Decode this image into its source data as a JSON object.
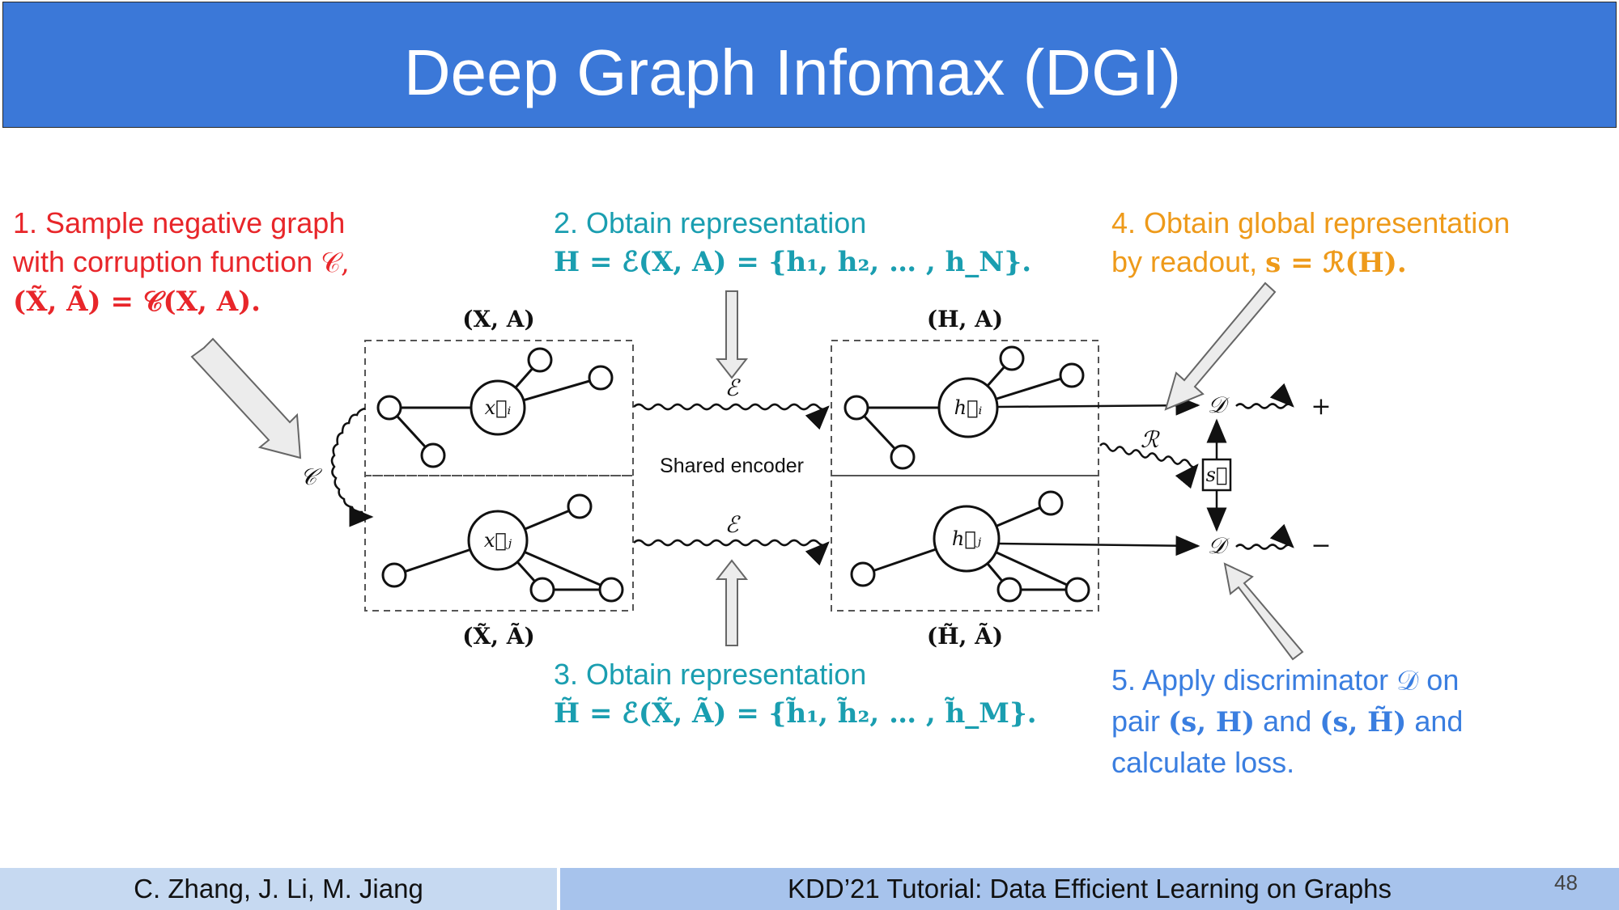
{
  "title": "Deep Graph Infomax (DGI)",
  "step1": {
    "line1": "1. Sample negative graph",
    "line2": "with corruption function ",
    "line2_math": "𝒞,",
    "line3_math": "(X̃, Ã) = 𝒞(X, A)."
  },
  "step2": {
    "line1": "2. Obtain representation",
    "line2_math": "H = ℰ(X, A) = {h₁, h₂, … , h_N}."
  },
  "step3": {
    "line1": "3. Obtain representation",
    "line2_math": "H̃ = ℰ(X̃, Ã) = {h̃₁, h̃₂, … , h̃_M}."
  },
  "step4": {
    "line1": "4. Obtain global representation",
    "line2": "by readout, ",
    "line2_math": "s = ℛ(H)."
  },
  "step5": {
    "line1": "5. Apply discriminator ",
    "line1_math": "𝒟",
    "line1_end": " on",
    "line2": "pair ",
    "line2_math1": "(s, H)",
    "line2_mid": " and ",
    "line2_math2": "(s, H̃)",
    "line2_end": " and",
    "line3": "calculate loss."
  },
  "diagram": {
    "label_xa": "(X, A)",
    "label_xa_tilde": "(X̃, Ã)",
    "label_ha": "(H, A)",
    "label_ha_tilde": "(H̃, Ã)",
    "node_xi": "x⃗ᵢ",
    "node_xj": "x⃗ⱼ",
    "node_hi": "h⃗ᵢ",
    "node_hj": "h⃗ⱼ",
    "encoder_symbol": "ℰ",
    "corruption_symbol": "𝒞",
    "readout_symbol": "ℛ",
    "discriminator_symbol": "𝒟",
    "summary_symbol": "s⃗",
    "plus": "+",
    "minus": "−",
    "shared_encoder": "Shared encoder"
  },
  "footer": {
    "authors": "C. Zhang, J. Li, M. Jiang",
    "event": "KDD’21 Tutorial: Data Efficient Learning on Graphs",
    "page_number": "48"
  },
  "colors": {
    "title_bar": "#3b78d8",
    "step1": "#e8262a",
    "step2_3": "#1a9eb0",
    "step4": "#ee9a1a",
    "step5": "#3a7ee0",
    "footer_left": "#c6d9f1",
    "footer_right": "#a7c3ec"
  }
}
